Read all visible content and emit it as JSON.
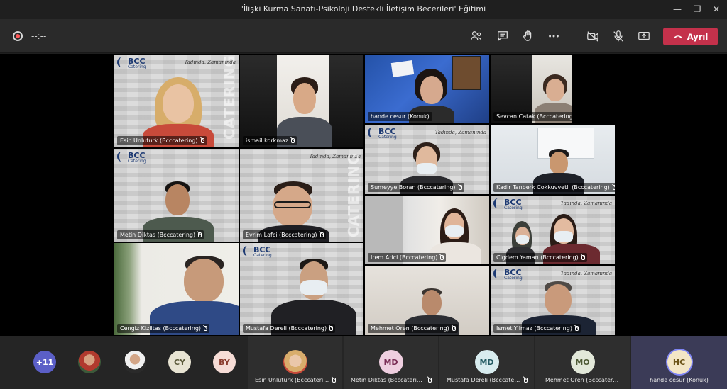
{
  "window": {
    "title": "'İlişki Kurma Sanatı-Psikoloji Destekli İletişim Becerileri' Eğitimi"
  },
  "toolbar": {
    "timer": "--:--",
    "leave_label": "Ayrıl"
  },
  "brand": {
    "logo_big": "BCC",
    "logo_small": "Catering",
    "slogan": "Tadında, Zamanında",
    "poster_word": "CATERING"
  },
  "tiles": [
    {
      "name": "Esin Unluturk (Bcccatering)"
    },
    {
      "name": "ismail korkmaz"
    },
    {
      "name": "hande cesur (Konuk)"
    },
    {
      "name": "Sevcan Catak (Bcccatering)"
    },
    {
      "name": "Sumeyye Boran (Bcccatering)"
    },
    {
      "name": "Kadir Tanberk Cokkuvvetli (Bcccatering)"
    },
    {
      "name": "Metin Diktas (Bcccatering)"
    },
    {
      "name": "Evrim Lafci (Bcccatering)"
    },
    {
      "name": "Irem Arici (Bcccatering)"
    },
    {
      "name": "Cigdem Yaman (Bcccatering)"
    },
    {
      "name": "Cengiz Kiziltas (Bcccatering)"
    },
    {
      "name": "Mustafa Dereli (Bcccatering)"
    },
    {
      "name": "Mehmet Oren (Bcccatering)"
    },
    {
      "name": "Ismet Yilmaz (Bcccatering)"
    }
  ],
  "strip": {
    "overflow_count": "+11",
    "small_avatars": [
      {
        "initials": "CY",
        "color": "#e8e4d3",
        "text_color": "#5b5a3a"
      },
      {
        "initials": "BY",
        "color": "#f6dcd6",
        "text_color": "#8a3b2d"
      }
    ],
    "participants": [
      {
        "name": "Esin Unluturk (Bcccatering)",
        "initials": "",
        "color": "#e0b68c",
        "text_color": "#000000"
      },
      {
        "name": "Metin Diktas (Bcccatering)",
        "initials": "MD",
        "color": "#efcfe0",
        "text_color": "#7a2d55"
      },
      {
        "name": "Mustafa Dereli (Bcccatering)",
        "initials": "MD",
        "color": "#d8ecef",
        "text_color": "#245b63"
      },
      {
        "name": "Mehmet Oren (Bcccatering)",
        "initials": "MO",
        "color": "#e2e8d9",
        "text_color": "#4e5a35"
      },
      {
        "name": "hande cesur (Konuk)",
        "initials": "HC",
        "color": "#f3e6c6",
        "text_color": "#6b5316"
      }
    ]
  }
}
